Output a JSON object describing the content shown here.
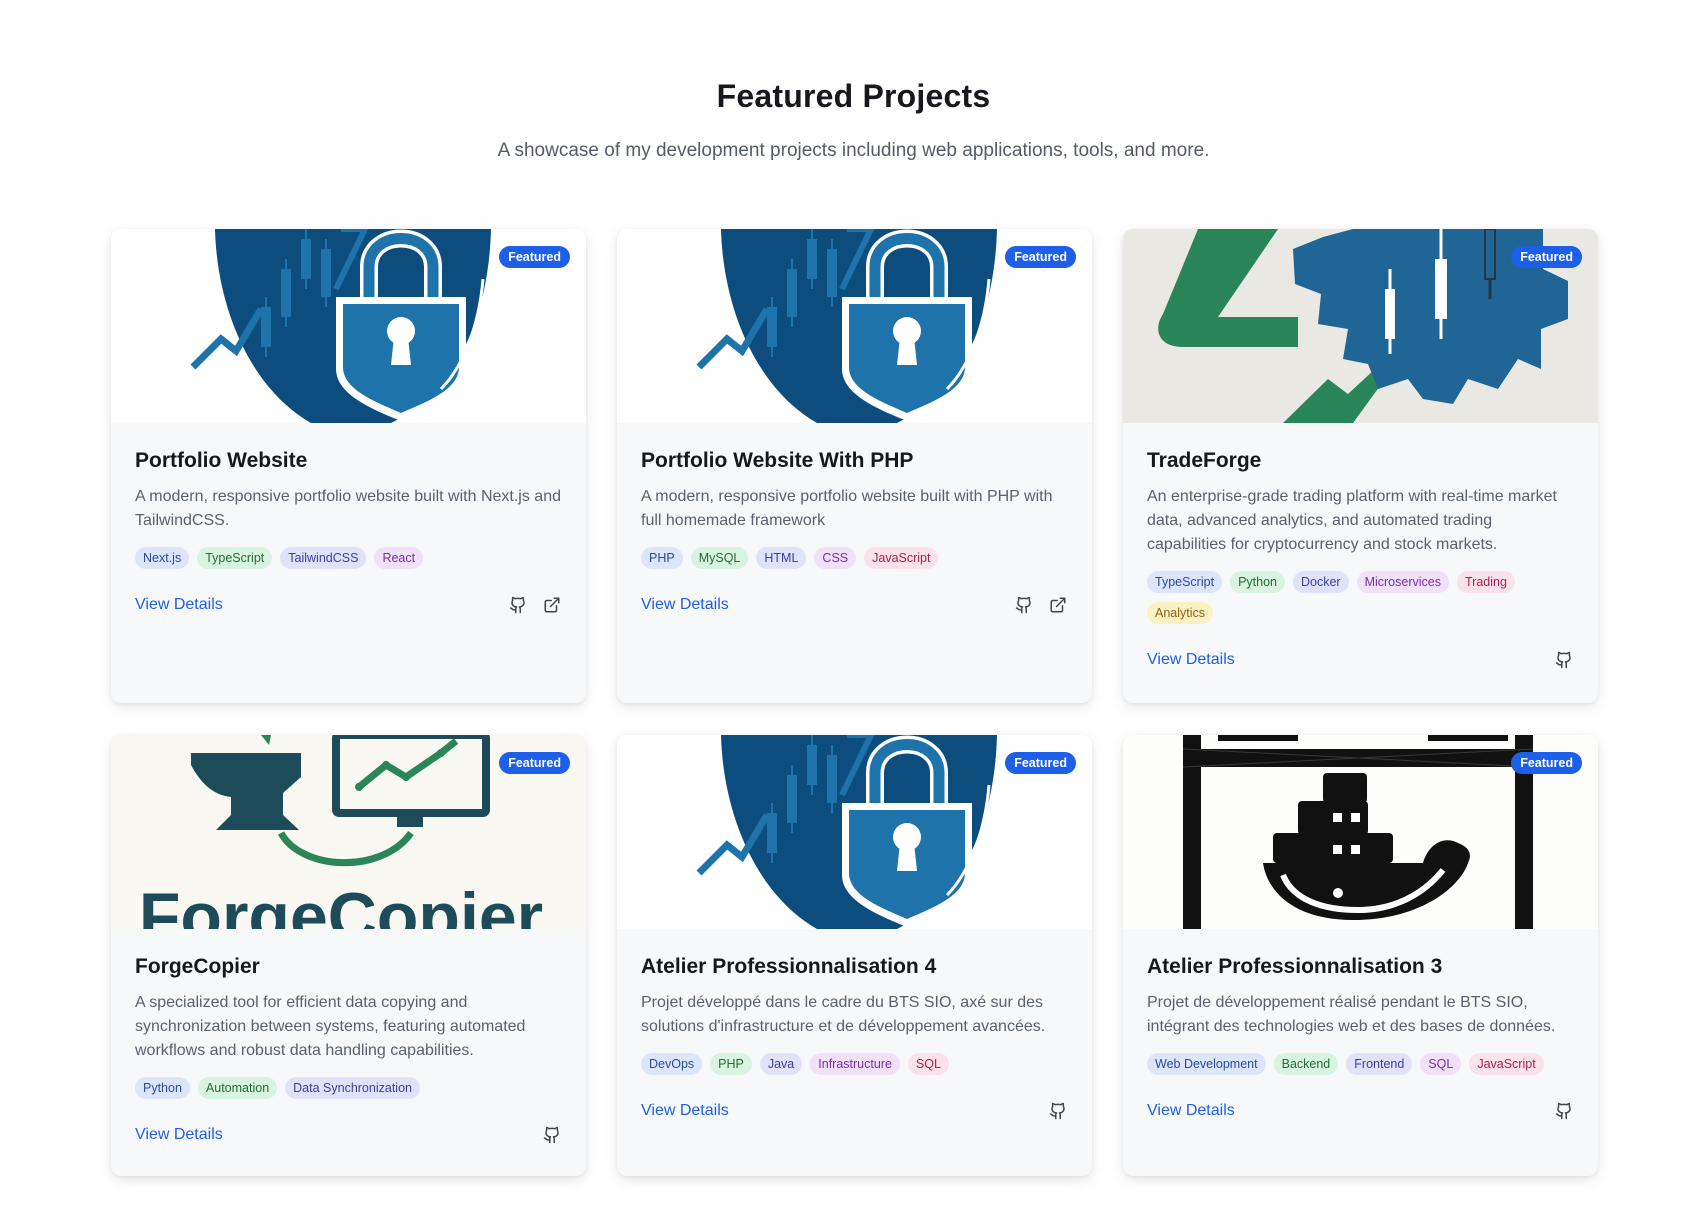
{
  "header": {
    "title": "Featured Projects",
    "subtitle": "A showcase of my development projects including web applications, tools, and more."
  },
  "colors": {
    "accent": "#1d5fe8",
    "card_bg": "#f7f8fa"
  },
  "projects": [
    {
      "image": "lock-shield-logo",
      "badge": "Featured",
      "title": "Portfolio Website",
      "description": "A modern, responsive portfolio website built with Next.js and TailwindCSS.",
      "tags": [
        "Next.js",
        "TypeScript",
        "TailwindCSS",
        "React"
      ],
      "link": "View Details",
      "icons": [
        "github-icon",
        "external-link-icon"
      ]
    },
    {
      "image": "lock-shield-logo",
      "badge": "Featured",
      "title": "Portfolio Website With PHP",
      "description": "A modern, responsive portfolio website built with PHP with full homemade framework",
      "tags": [
        "PHP",
        "MySQL",
        "HTML",
        "CSS",
        "JavaScript"
      ],
      "link": "View Details",
      "icons": [
        "github-icon",
        "external-link-icon"
      ]
    },
    {
      "image": "tradeforge-logo",
      "badge": "Featured",
      "title": "TradeForge",
      "description": "An enterprise-grade trading platform with real-time market data, advanced analytics, and automated trading capabilities for cryptocurrency and stock markets.",
      "tags": [
        "TypeScript",
        "Python",
        "Docker",
        "Microservices",
        "Trading",
        "Analytics"
      ],
      "link": "View Details",
      "icons": [
        "github-icon"
      ]
    },
    {
      "image": "forgecopier-logo",
      "image_text": "ForgeCopier",
      "badge": "Featured",
      "title": "ForgeCopier",
      "description": "A specialized tool for efficient data copying and synchronization between systems, featuring automated workflows and robust data handling capabilities.",
      "tags": [
        "Python",
        "Automation",
        "Data Synchronization"
      ],
      "link": "View Details",
      "icons": [
        "github-icon"
      ]
    },
    {
      "image": "lock-shield-logo",
      "badge": "Featured",
      "title": "Atelier Professionnalisation 4",
      "description": "Projet développé dans le cadre du BTS SIO, axé sur des solutions d'infrastructure et de développement avancées.",
      "tags": [
        "DevOps",
        "PHP",
        "Java",
        "Infrastructure",
        "SQL"
      ],
      "link": "View Details",
      "icons": [
        "github-icon"
      ]
    },
    {
      "image": "docker-logo",
      "badge": "Featured",
      "title": "Atelier Professionnalisation 3",
      "description": "Projet de développement réalisé pendant le BTS SIO, intégrant des technologies web et des bases de données.",
      "tags": [
        "Web Development",
        "Backend",
        "Frontend",
        "SQL",
        "JavaScript"
      ],
      "link": "View Details",
      "icons": [
        "github-icon"
      ]
    }
  ]
}
